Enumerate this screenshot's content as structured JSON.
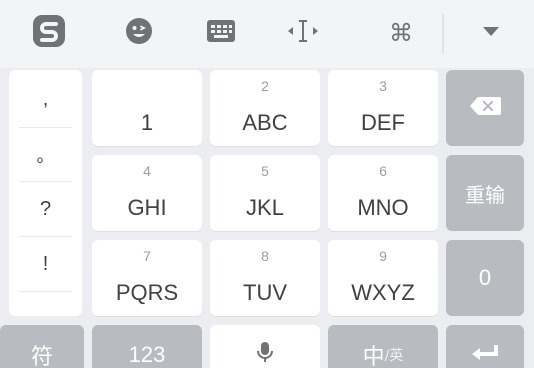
{
  "toolbar": {
    "items": [
      {
        "icon": "sogou-logo-icon"
      },
      {
        "icon": "emoji-icon"
      },
      {
        "icon": "keyboard-icon"
      },
      {
        "icon": "cursor-move-icon"
      },
      {
        "icon": "command-icon"
      },
      {
        "icon": "collapse-keyboard-icon"
      }
    ],
    "command_glyph": "⌘"
  },
  "punctuation": [
    ",",
    "。",
    "?",
    "!"
  ],
  "keys": {
    "k1": {
      "num": "",
      "label": "1"
    },
    "k2": {
      "num": "2",
      "label": "ABC"
    },
    "k3": {
      "num": "3",
      "label": "DEF"
    },
    "k4": {
      "num": "4",
      "label": "GHI"
    },
    "k5": {
      "num": "5",
      "label": "JKL"
    },
    "k6": {
      "num": "6",
      "label": "MNO"
    },
    "k7": {
      "num": "7",
      "label": "PQRS"
    },
    "k8": {
      "num": "8",
      "label": "TUV"
    },
    "k9": {
      "num": "9",
      "label": "WXYZ"
    }
  },
  "side_keys": {
    "delete_icon": "backspace-icon",
    "reinput": "重输",
    "zero": "0"
  },
  "bottom_row": {
    "symbols": "符",
    "numbers": "123",
    "space_icon": "microphone-icon",
    "lang_main": "中",
    "lang_sub": "/英",
    "enter_icon": "enter-icon"
  },
  "colors": {
    "background": "#ebedf0",
    "toolbar": "#f3f4f6",
    "key": "#ffffff",
    "function_key": "#b8bbc0",
    "icon": "#6f7277"
  }
}
